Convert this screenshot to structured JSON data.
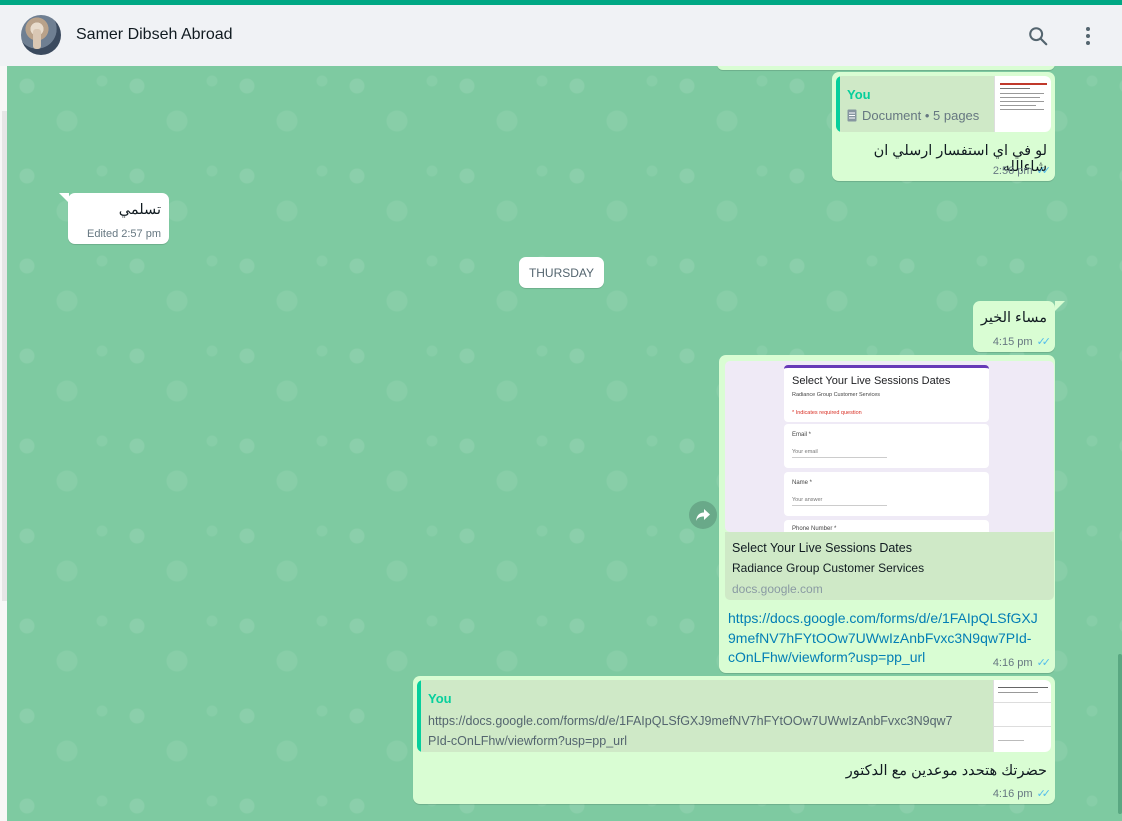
{
  "header": {
    "contact_name": "Samer Dibseh Abroad"
  },
  "icons": {
    "search": "search-icon",
    "menu": "more-vertical-icon",
    "forward": "forward-icon",
    "document": "document-icon",
    "ticks": "double-check-icon"
  },
  "colors": {
    "accent": "#00a884",
    "outgoing": "#d9fdd3",
    "incoming": "#ffffff",
    "wallpaper": "#7ecaa1",
    "link": "#027eb5",
    "ticks": "#53bdeb"
  },
  "messages": {
    "m1": {
      "quote_author": "You",
      "quote_doc": "Document • 5 pages",
      "text": "لو في اي استفسار ارسلي ان شاءالله",
      "time": "2:56 pm"
    },
    "m2": {
      "text": "تسلمي",
      "time": "Edited 2:57 pm"
    },
    "day_separator": "THURSDAY",
    "m3": {
      "text": "مساء الخير",
      "time": "4:15 pm"
    },
    "m4": {
      "thumb": {
        "title": "Select Your Live Sessions Dates",
        "subtitle": "Radiance Group Customer Services",
        "required": "* Indicates required question",
        "email_label": "Email *",
        "email_hint": "Your email",
        "name_label": "Name *",
        "name_hint": "Your answer",
        "phone_label": "Phone Number *"
      },
      "preview_title": "Select Your Live Sessions Dates",
      "preview_desc": "Radiance Group Customer Services",
      "preview_domain": "docs.google.com",
      "link_line1": "https://docs.google.com/forms/d/e/1FAIpQLSfGXJ",
      "link_line2": "9mefNV7hFYtOOw7UWwIzAnbFvxc3N9qw7PId-",
      "link_line3": "cOnLFhw/viewform?usp=pp_url",
      "time": "4:16 pm"
    },
    "m5": {
      "quote_author": "You",
      "quote_line1": "https://docs.google.com/forms/d/e/1FAIpQLSfGXJ9mefNV7hFYtOOw7UWwIzAnbFvxc3N9qw7",
      "quote_line2": "PId-cOnLFhw/viewform?usp=pp_url",
      "text": "حضرتك هتحدد موعدين مع الدكتور",
      "time": "4:16 pm"
    }
  }
}
